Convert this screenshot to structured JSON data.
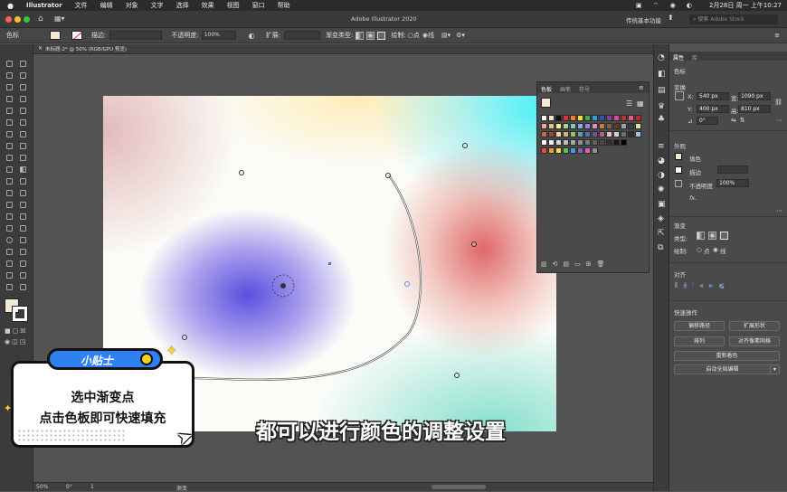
{
  "menubar": {
    "apple": "",
    "app": "Illustrator",
    "items": [
      "文件",
      "编辑",
      "对象",
      "文字",
      "选择",
      "效果",
      "视图",
      "窗口",
      "帮助"
    ],
    "clock": "2月28日 周一 上午10:27"
  },
  "titlebar": {
    "title": "Adobe Illustrator 2020",
    "workspace": "传统基本功能",
    "search_placeholder": "搜索 Adobe Stock"
  },
  "control": {
    "type_label": "色标",
    "stroke_label": "描边:",
    "opacity_label": "不透明度:",
    "opacity_value": "100%",
    "spread_label": "扩展:",
    "gradient_type_label": "渐变类型:",
    "draw_label": "绘制:",
    "draw_opt1": "点",
    "draw_opt2": "线"
  },
  "doc_tab": "未标题-2* @ 50% (RGB/GPU 预览)",
  "status": {
    "zoom": "50%",
    "angle": "0°",
    "page": "1",
    "tool": "渐变"
  },
  "swatches": {
    "tabs": [
      "色板",
      "画笔",
      "符号"
    ],
    "row1": [
      "#ffffff",
      "#f0e6d2",
      "#111111",
      "#e03030",
      "#f08020",
      "#f6e030",
      "#40b040",
      "#30a0d0",
      "#3050c0",
      "#8040a0",
      "#e040a0",
      "#c03030",
      "#e06080",
      "#d02020"
    ],
    "row2": [
      "#f0a0a0",
      "#f0c080",
      "#f8f080",
      "#a0d890",
      "#80c8c0",
      "#80b0e0",
      "#a080d0",
      "#e090c0",
      "#c08040",
      "#806040",
      "#604020",
      "#a0a0a0",
      "#404040",
      "#e0e0a0"
    ],
    "row3": [
      "#c07050",
      "#905030",
      "#f0d0a0",
      "#d0b080",
      "#90c060",
      "#60a0a0",
      "#5070b0",
      "#7050a0",
      "#b06090",
      "#e8c0c0",
      "#d0d0d0",
      "#707070",
      "#303030",
      "#a0c0e0"
    ],
    "row4": [
      "#ffffff",
      "#f0f0f0",
      "#d8d8d8",
      "#c0c0c0",
      "#a8a8a8",
      "#909090",
      "#787878",
      "#606060",
      "#484848",
      "#303030",
      "#181818",
      "#000000"
    ],
    "row5": [
      "#e05050",
      "#f0a030",
      "#f0e040",
      "#60c060",
      "#40a0e0",
      "#8060c0",
      "#e060b0",
      "#909090"
    ]
  },
  "properties": {
    "tabs": [
      "属性",
      "库"
    ],
    "selection": "色标",
    "transform_title": "变换",
    "x_label": "X:",
    "x_value": "540 px",
    "y_label": "Y:",
    "y_value": "400 px",
    "w_label": "宽:",
    "w_value": "1090 px",
    "h_label": "高:",
    "h_value": "810 px",
    "angle_value": "0°",
    "appearance_title": "外观",
    "fill_label": "填色",
    "stroke_label": "描边",
    "opacity_label": "不透明度",
    "opacity_value": "100%",
    "fx_label": "fx.",
    "gradient_title": "渐变",
    "type_label": "类型:",
    "draw_label": "绘制:",
    "draw_opt1": "点",
    "draw_opt2": "线",
    "align_title": "对齐",
    "quick_title": "快速操作",
    "btn_offset": "偏移路径",
    "btn_expand": "扩展形状",
    "btn_arrange": "排列",
    "btn_pixel": "对齐像素网格",
    "btn_recolor": "重新着色",
    "btn_global": "启动全局编辑"
  },
  "tip": {
    "tag": "小贴士",
    "line1": "选中渐变点",
    "line2": "点击色板即可快速填充"
  },
  "subtitle": "都可以进行颜色的调整设置",
  "colors": {
    "tip_blue": "#2f80f2",
    "tip_dot": "#ffd21f",
    "accent": "#2f80f2"
  }
}
